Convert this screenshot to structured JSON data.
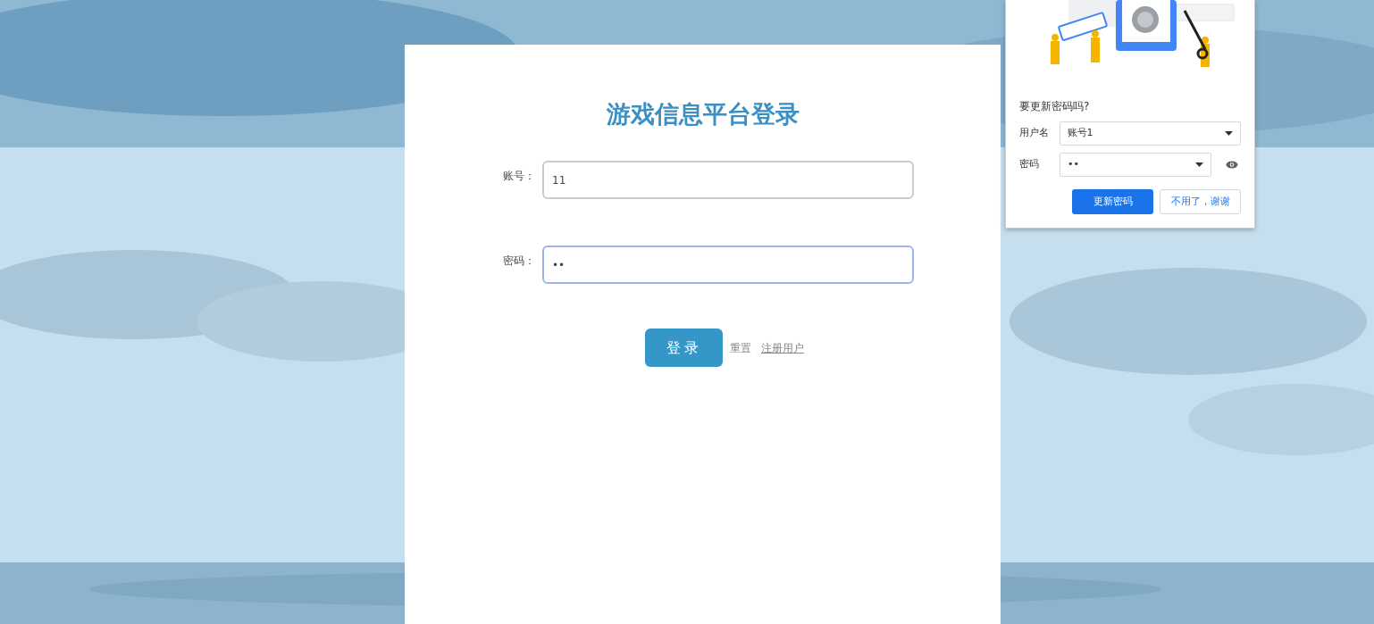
{
  "login": {
    "title": "游戏信息平台登录",
    "fields": [
      {
        "label": "账号：",
        "value": "11",
        "focused": false
      },
      {
        "label": "密码：",
        "value": "••",
        "focused": true
      }
    ],
    "buttons": [
      {
        "label": "登录",
        "kind": "primary"
      },
      {
        "label": "重置",
        "kind": "text"
      },
      {
        "label": "注册用户",
        "kind": "link"
      }
    ]
  },
  "password_prompt": {
    "title": "要更新密码吗?",
    "rows": [
      {
        "label": "用户名",
        "value": "账号1",
        "kind": "select"
      },
      {
        "label": "密码",
        "value": "••",
        "kind": "password"
      }
    ],
    "buttons": [
      {
        "label": "更新密码",
        "kind": "primary"
      },
      {
        "label": "不用了，谢谢",
        "kind": "secondary"
      }
    ]
  }
}
